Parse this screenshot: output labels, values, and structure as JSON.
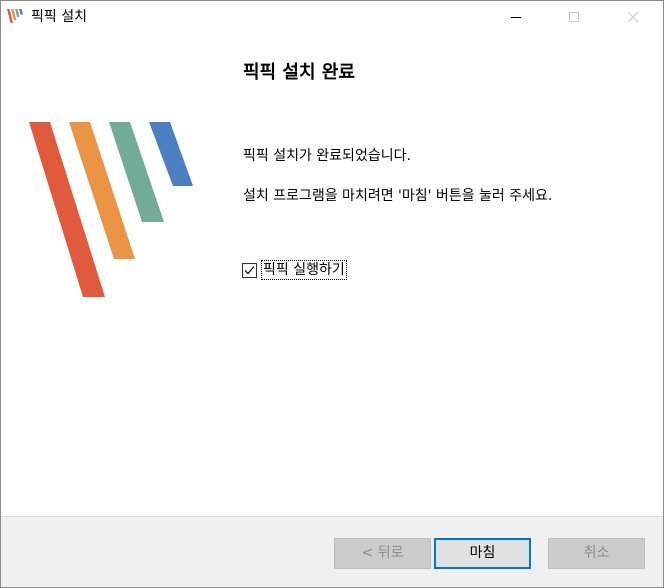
{
  "window": {
    "title": "픽픽 설치"
  },
  "content": {
    "heading": "픽픽 설치 완료",
    "message_complete": "픽픽 설치가 완료되었습니다.",
    "message_instruction": "설치 프로그램을 마치려면 '마침' 버튼을 눌러 주세요.",
    "launch_checkbox": {
      "label": "픽픽 실행하기",
      "checked": true
    }
  },
  "buttons": {
    "back": "< 뒤로",
    "finish": "마침",
    "cancel": "취소"
  },
  "colors": {
    "stripe_red": "#e05a3e",
    "stripe_orange": "#ec9446",
    "stripe_green": "#72ab96",
    "stripe_blue": "#4a7fc1",
    "focus_blue": "#0078d7"
  }
}
